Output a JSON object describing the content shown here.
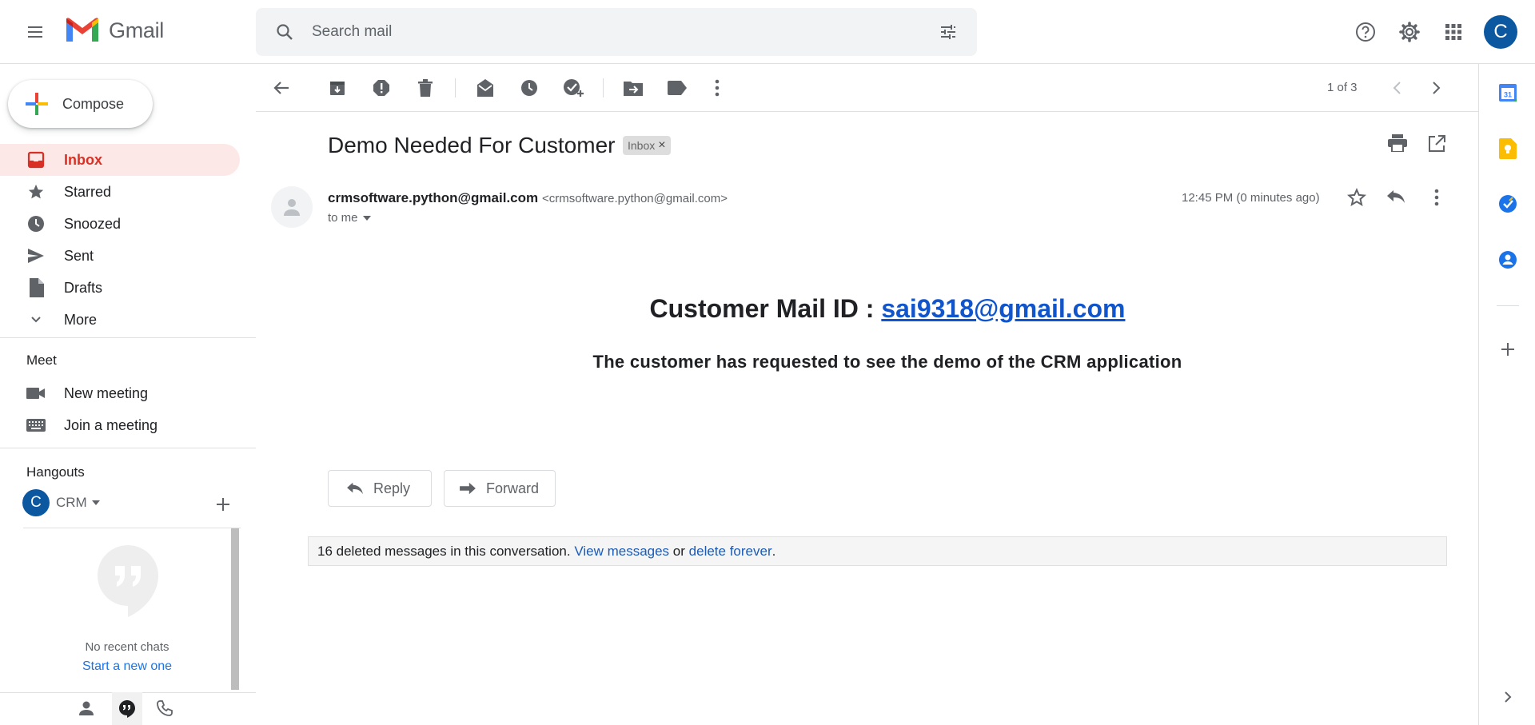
{
  "app": {
    "name": "Gmail"
  },
  "search": {
    "placeholder": "Search mail"
  },
  "account": {
    "initial": "C"
  },
  "sidebar": {
    "compose_label": "Compose",
    "items": [
      {
        "label": "Inbox",
        "icon": "inbox-icon",
        "active": true
      },
      {
        "label": "Starred",
        "icon": "star-icon"
      },
      {
        "label": "Snoozed",
        "icon": "clock-icon"
      },
      {
        "label": "Sent",
        "icon": "send-icon"
      },
      {
        "label": "Drafts",
        "icon": "draft-icon"
      },
      {
        "label": "More",
        "icon": "chevron-down-icon"
      }
    ],
    "meet": {
      "title": "Meet",
      "items": [
        {
          "label": "New meeting",
          "icon": "video-icon"
        },
        {
          "label": "Join a meeting",
          "icon": "keyboard-icon"
        }
      ]
    },
    "hangouts": {
      "title": "Hangouts",
      "user_initial": "C",
      "user_name": "CRM",
      "empty_text": "No recent chats",
      "start_link": "Start a new one"
    }
  },
  "toolbar": {
    "pager": "1 of 3"
  },
  "message": {
    "subject": "Demo Needed For Customer",
    "label_chip": "Inbox",
    "sender_name": "crmsoftware.python@gmail.com",
    "sender_email": "<crmsoftware.python@gmail.com>",
    "recipient": "to me",
    "time": "12:45 PM (0 minutes ago)",
    "body_heading_prefix": "Customer Mail ID : ",
    "body_heading_link": "sai9318@gmail.com",
    "body_line": "The customer has requested to see the demo of the CRM application",
    "reply_label": "Reply",
    "forward_label": "Forward",
    "deleted_text": "16 deleted messages in this conversation.",
    "view_messages_link": "View messages",
    "or_text": "or",
    "delete_forever_link": "delete forever",
    "period": "."
  },
  "colors": {
    "accent_red": "#d93025",
    "link_blue": "#1155cc",
    "active_bg": "#fce8e6",
    "avatar_blue": "#0b57a0"
  }
}
